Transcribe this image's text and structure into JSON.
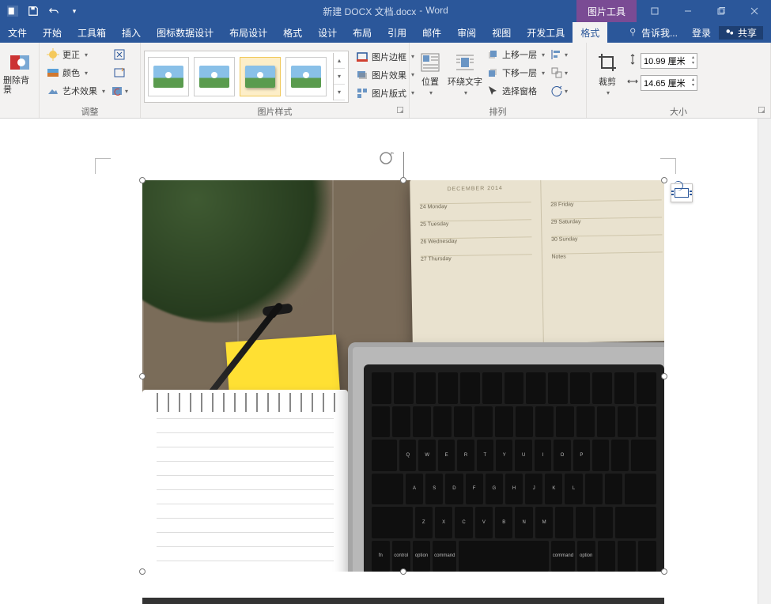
{
  "title": {
    "doc": "新建 DOCX 文档.docx",
    "app": "Word",
    "context_tab": "图片工具"
  },
  "qat": {
    "save": "保存",
    "undo": "撤销"
  },
  "win": {
    "min": "最小化",
    "restore": "还原",
    "close": "关闭"
  },
  "tabs": {
    "file": "文件",
    "home": "开始",
    "toolkit": "工具箱",
    "insert": "插入",
    "chartdata": "图标数据设计",
    "layout": "布局设计",
    "format1": "格式",
    "design": "设计",
    "layout2": "布局",
    "references": "引用",
    "mailings": "邮件",
    "review": "审阅",
    "view": "视图",
    "developer": "开发工具",
    "format_pic": "格式",
    "tellme": "告诉我...",
    "login": "登录",
    "share": "共享"
  },
  "ribbon": {
    "remove_bg": "删除背景",
    "adjust": {
      "label": "调整",
      "corrections": "更正",
      "color": "颜色",
      "artistic": "艺术效果"
    },
    "styles": {
      "label": "图片样式",
      "border": "图片边框",
      "effects": "图片效果",
      "layout": "图片版式"
    },
    "arrange": {
      "label": "排列",
      "position": "位置",
      "wrap": "环绕文字",
      "forward": "上移一层",
      "backward": "下移一层",
      "selection": "选择窗格"
    },
    "size": {
      "label": "大小",
      "crop": "裁剪",
      "height_value": "10.99 厘米",
      "width_value": "14.65 厘米"
    }
  },
  "planner": {
    "header": "DECEMBER 2014",
    "left": [
      "24 Monday",
      "25 Tuesday",
      "26 Wednesday",
      "27 Thursday"
    ],
    "right": [
      "28 Friday",
      "29 Saturday",
      "30 Sunday",
      "Notes"
    ]
  }
}
